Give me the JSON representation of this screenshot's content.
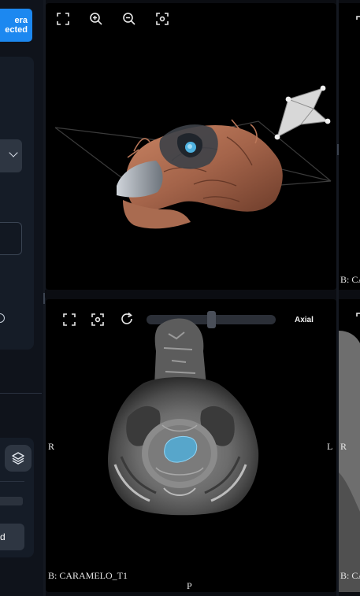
{
  "sidebar": {
    "camera_button_label": "era\nected",
    "action_button_label": "d"
  },
  "viewports": {
    "top_left": {
      "type": "3D",
      "tools": [
        "fullscreen-icon",
        "zoom-in-icon",
        "zoom-out-icon",
        "focus-icon"
      ]
    },
    "bottom_left": {
      "type": "2D",
      "view_name": "Axial",
      "slice_position": 0.5,
      "series_label": "B: CARAMELO_T1",
      "orientation": {
        "left": "R",
        "right": "L",
        "bottom": "P"
      },
      "tools": [
        "fullscreen-icon",
        "focus-icon",
        "rotate-icon"
      ]
    },
    "top_right": {
      "series_label": "B: CA"
    },
    "bottom_right": {
      "orientation_left": "R",
      "series_label": "B: CA"
    }
  },
  "colors": {
    "accent": "#1c88f0",
    "segmentation": "#4fb2e0",
    "surface": "#b07055"
  }
}
